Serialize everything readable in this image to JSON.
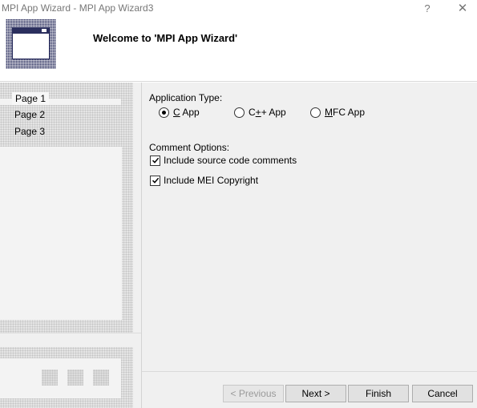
{
  "window": {
    "title": "MPI App Wizard - MPI App Wizard3",
    "help_glyph": "?",
    "close_glyph": "✕"
  },
  "header": {
    "welcome": "Welcome to 'MPI App Wizard'",
    "logo_icon": "app-window-icon"
  },
  "sidebar": {
    "items": [
      {
        "label": "Page 1",
        "active": true
      },
      {
        "label": "Page 2",
        "active": false
      },
      {
        "label": "Page 3",
        "active": false
      }
    ]
  },
  "main": {
    "app_type": {
      "label": "Application Type:",
      "options": [
        {
          "pre": "",
          "mnemonic": "C",
          "post": " App",
          "checked": true
        },
        {
          "pre": "C",
          "mnemonic": "+",
          "post": "+ App",
          "checked": false
        },
        {
          "pre": "",
          "mnemonic": "M",
          "post": "FC App",
          "checked": false
        }
      ]
    },
    "comment_options": {
      "label": "Comment Options:",
      "checks": [
        {
          "label": "Include source code comments",
          "checked": true
        },
        {
          "label": "Include MEI Copyright",
          "checked": true
        }
      ]
    }
  },
  "buttons": {
    "previous": "< Previous",
    "next": "Next >",
    "finish": "Finish",
    "cancel": "Cancel"
  }
}
